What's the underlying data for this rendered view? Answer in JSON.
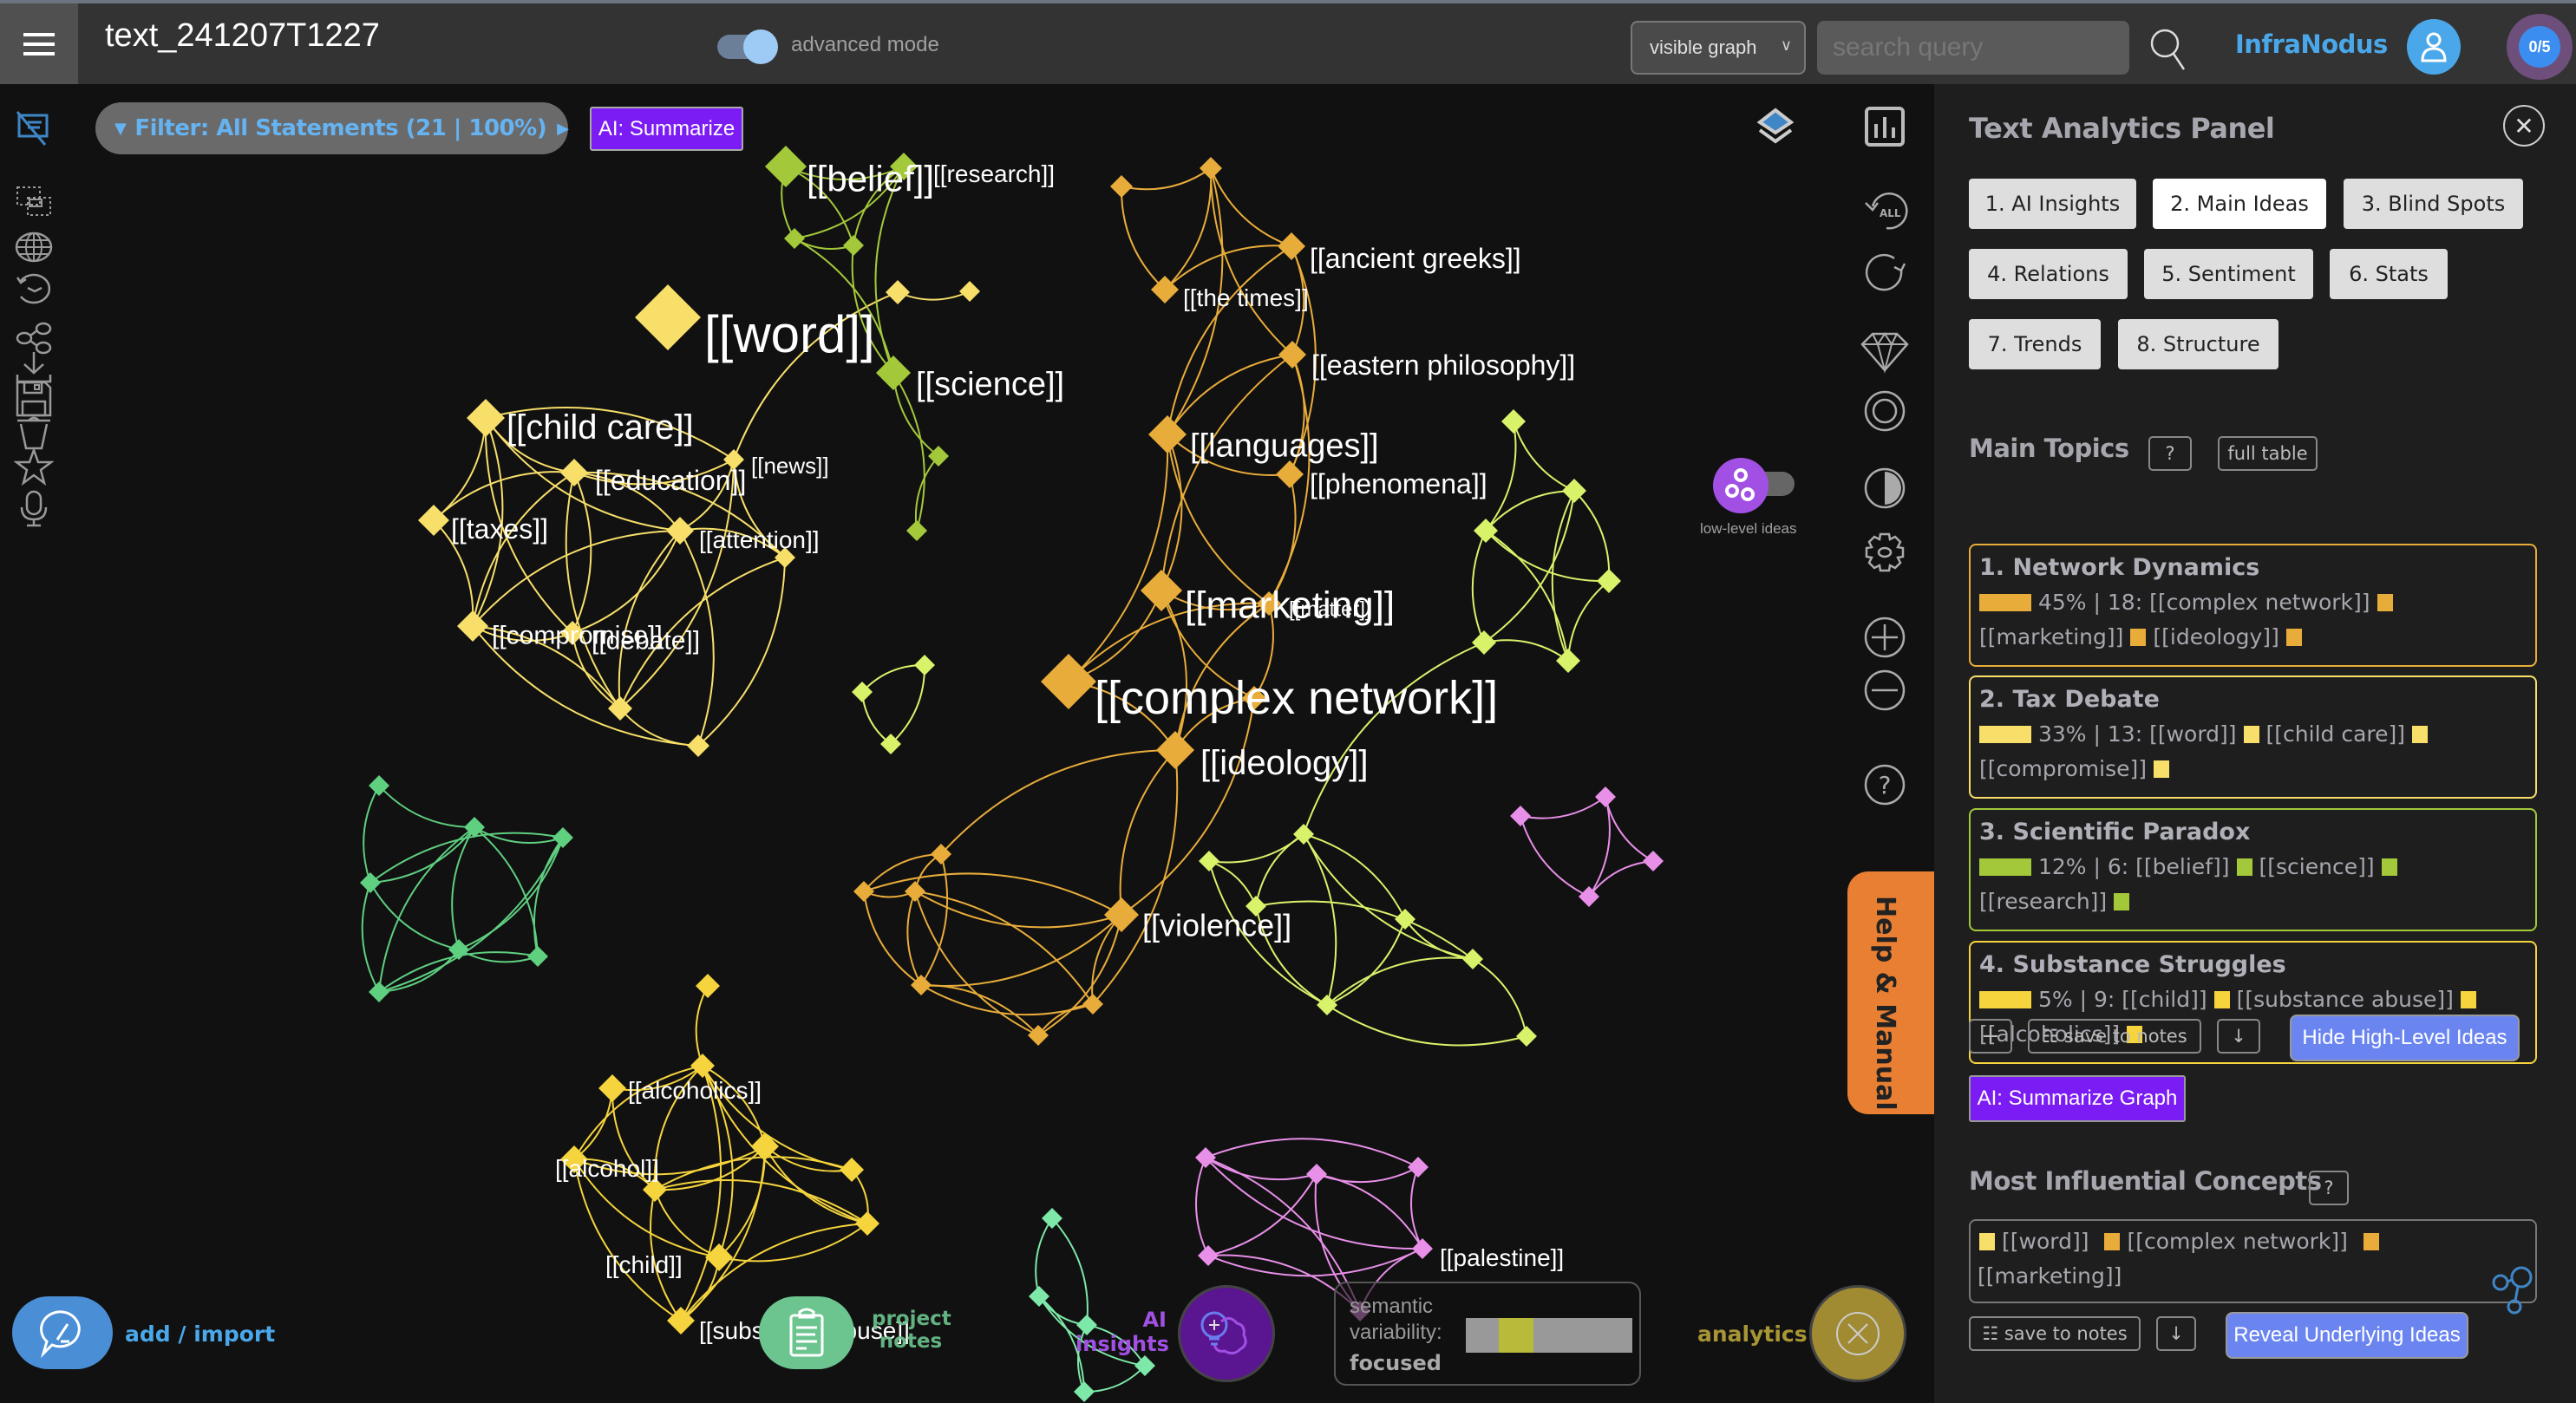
{
  "app": {
    "document_title": "text_241207T1227",
    "advanced_mode_label": "advanced mode",
    "advanced_mode_on": true,
    "graph_scope_select": "visible graph",
    "search_placeholder": "search query",
    "brand": "InfraNodus",
    "quota": "0/5"
  },
  "toolbar": {
    "filter_label": "Filter: All Statements (21 | 100%)",
    "ai_summarize_label": "AI: Summarize",
    "low_level_ideas_label": "low-level ideas",
    "help_tab_label": "Help & Manual"
  },
  "left_sidebar": {
    "icons": [
      "hide-statements-icon",
      "select-area-icon",
      "globe-icon",
      "history-icon",
      "share-icon",
      "download-icon",
      "save-icon",
      "trash-icon",
      "star-icon",
      "microphone-icon"
    ]
  },
  "right_rail": {
    "icons": [
      "stats-chart-icon",
      "reset-all-icon",
      "reload-icon",
      "gem-icon",
      "focus-ring-icon",
      "contrast-icon",
      "settings-gear-icon",
      "zoom-in-icon",
      "zoom-out-icon",
      "help-icon"
    ]
  },
  "bottom": {
    "add_import_label": "add / import",
    "project_notes_label": "project notes",
    "ai_insights_label": "AI insights",
    "semantic_variability_label": "semantic variability:",
    "semantic_variability_value": "focused",
    "semantic_variability_level": 0.3,
    "analytics_label": "analytics"
  },
  "panel": {
    "title": "Text Analytics Panel",
    "tabs": [
      {
        "label": "1. AI Insights",
        "active": false
      },
      {
        "label": "2. Main Ideas",
        "active": true
      },
      {
        "label": "3. Blind Spots",
        "active": false
      },
      {
        "label": "4. Relations",
        "active": false
      },
      {
        "label": "5. Sentiment",
        "active": false
      },
      {
        "label": "6. Stats",
        "active": false
      },
      {
        "label": "7. Trends",
        "active": false
      },
      {
        "label": "8. Structure",
        "active": false
      }
    ],
    "main_topics": {
      "title": "Main Topics",
      "help_label": "?",
      "full_table_label": "full table",
      "topics": [
        {
          "title": "1. Network Dynamics",
          "share": "45%",
          "count": "18",
          "color": "#e8ac3a",
          "concepts": [
            "[[complex network]]",
            "[[marketing]]",
            "[[ideology]]"
          ]
        },
        {
          "title": "2. Tax Debate",
          "share": "33%",
          "count": "13",
          "color": "#f7df6a",
          "concepts": [
            "[[word]]",
            "[[child care]]",
            "[[compromise]]"
          ]
        },
        {
          "title": "3. Scientific Paradox",
          "share": "12%",
          "count": "6",
          "color": "#a3c93a",
          "concepts": [
            "[[belief]]",
            "[[science]]",
            "[[research]]"
          ]
        },
        {
          "title": "4. Substance Struggles",
          "share": "5%",
          "count": "9",
          "color": "#f5d43d",
          "concepts": [
            "[[child]]",
            "[[substance abuse]]",
            "[[alcoholics]]"
          ]
        }
      ],
      "add_label": "+",
      "save_notes_label": "☷ save to notes",
      "download_label": "↓",
      "hide_high_level_label": "Hide High-Level Ideas",
      "ai_summarize_graph_label": "AI: Summarize Graph"
    },
    "influential": {
      "title": "Most Influential Concepts",
      "help_label": "?",
      "concepts": [
        {
          "label": "[[word]]",
          "color": "#f7df6a"
        },
        {
          "label": "[[complex network]]",
          "color": "#e8ac3a"
        },
        {
          "label": "[[marketing]]",
          "color": "#e8ac3a"
        }
      ],
      "save_notes_label": "☷ save to notes",
      "download_label": "↓",
      "reveal_label": "Reveal Underlying Ideas"
    }
  },
  "graph": {
    "clusters": [
      {
        "name": "network-dynamics",
        "color": "#e8ac3a"
      },
      {
        "name": "tax-debate",
        "color": "#f7df6a"
      },
      {
        "name": "scientific-paradox",
        "color": "#a3c93a"
      },
      {
        "name": "substance-struggles",
        "color": "#f5d43d"
      },
      {
        "name": "green-cluster",
        "color": "#5fcf80"
      },
      {
        "name": "pink-cluster",
        "color": "#e88fe8"
      },
      {
        "name": "lime-cluster",
        "color": "#d8f26a"
      },
      {
        "name": "mint-cluster",
        "color": "#7de8a8"
      }
    ],
    "labels": [
      {
        "text": "[[word]]",
        "cluster": "tax-debate"
      },
      {
        "text": "[[belief]]",
        "cluster": "scientific-paradox"
      },
      {
        "text": "[[research]]",
        "cluster": "scientific-paradox"
      },
      {
        "text": "[[science]]",
        "cluster": "scientific-paradox"
      },
      {
        "text": "[[child care]]",
        "cluster": "tax-debate"
      },
      {
        "text": "[[education]]",
        "cluster": "tax-debate"
      },
      {
        "text": "[[news]]",
        "cluster": "tax-debate"
      },
      {
        "text": "[[taxes]]",
        "cluster": "tax-debate"
      },
      {
        "text": "[[attention]]",
        "cluster": "tax-debate"
      },
      {
        "text": "[[compromise]]",
        "cluster": "tax-debate"
      },
      {
        "text": "[[debate]]",
        "cluster": "tax-debate"
      },
      {
        "text": "[[ancient greeks]]",
        "cluster": "network-dynamics"
      },
      {
        "text": "[[the times]]",
        "cluster": "network-dynamics"
      },
      {
        "text": "[[eastern philosophy]]",
        "cluster": "network-dynamics"
      },
      {
        "text": "[[languages]]",
        "cluster": "network-dynamics"
      },
      {
        "text": "[[phenomena]]",
        "cluster": "network-dynamics"
      },
      {
        "text": "[[marketing]]",
        "cluster": "network-dynamics"
      },
      {
        "text": "[[matter]]",
        "cluster": "network-dynamics"
      },
      {
        "text": "[[complex network]]",
        "cluster": "network-dynamics"
      },
      {
        "text": "[[ideology]]",
        "cluster": "network-dynamics"
      },
      {
        "text": "[[violence]]",
        "cluster": "network-dynamics"
      },
      {
        "text": "[[alcoholics]]",
        "cluster": "substance-struggles"
      },
      {
        "text": "[[alcohol]]",
        "cluster": "substance-struggles"
      },
      {
        "text": "[[child]]",
        "cluster": "substance-struggles"
      },
      {
        "text": "[[substance abuse]]",
        "cluster": "substance-struggles"
      },
      {
        "text": "[[palestine]]",
        "cluster": "pink-cluster"
      }
    ]
  }
}
